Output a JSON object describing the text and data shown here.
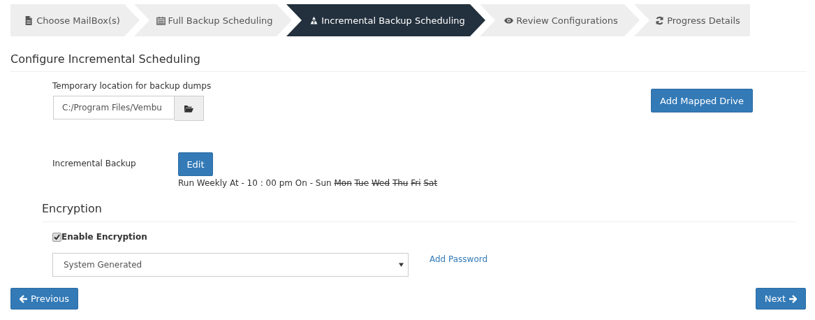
{
  "steps": [
    {
      "label": "Choose MailBox(s)",
      "selected": false
    },
    {
      "label": "Full Backup Scheduling",
      "selected": false
    },
    {
      "label": "Incremental Backup Scheduling",
      "selected": true
    },
    {
      "label": "Review Configurations",
      "selected": false
    },
    {
      "label": "Progress Details",
      "selected": false
    }
  ],
  "heading": "Configure Incremental Scheduling",
  "temp_location": {
    "label": "Temporary location for backup dumps",
    "value": "C:/Program Files/Vembu"
  },
  "add_mapped_drive": "Add Mapped Drive",
  "incremental": {
    "label": "Incremental Backup",
    "edit": "Edit",
    "schedule_prefix": "Run Weekly At - 10 : 00 pm On -",
    "days": [
      {
        "label": "Sun",
        "on": true
      },
      {
        "label": "Mon",
        "on": false
      },
      {
        "label": "Tue",
        "on": false
      },
      {
        "label": "Wed",
        "on": false
      },
      {
        "label": "Thu",
        "on": false
      },
      {
        "label": "Fri",
        "on": false
      },
      {
        "label": "Sat",
        "on": false
      }
    ]
  },
  "encryption": {
    "heading": "Encryption",
    "checkbox": {
      "label": "Enable Encryption",
      "checked": true
    },
    "select": "System Generated",
    "link": "Add Password"
  },
  "buttons": {
    "previous": "Previous",
    "next": "Next"
  }
}
